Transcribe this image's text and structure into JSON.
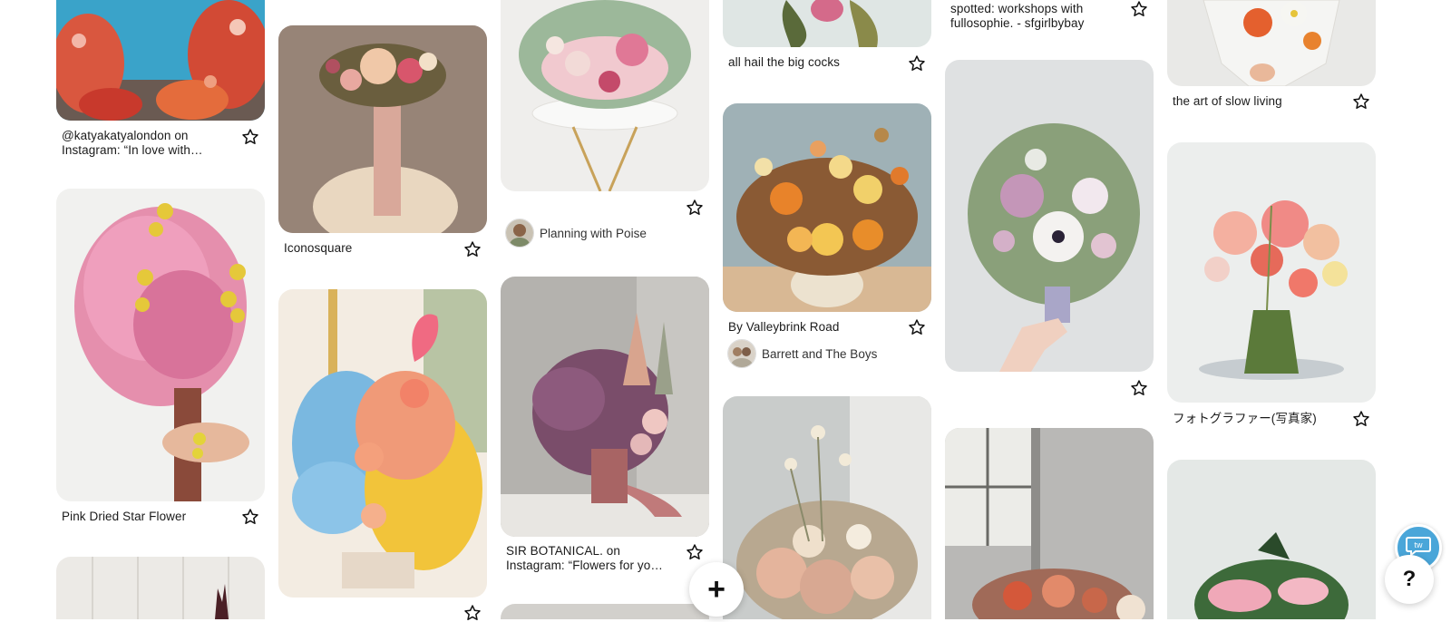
{
  "pins": [
    {
      "title": "@katyakatyalondon on Instagram: “In love with…"
    },
    {
      "title": "Pink Dried Star Flower"
    },
    {
      "title": "Iconosquare"
    },
    {
      "title": "",
      "attribution": "Planning with Poise"
    },
    {
      "title": "SIR BOTANICAL. on Instagram: “Flowers for yo…"
    },
    {
      "title": "all hail the big cocks"
    },
    {
      "title": "By Valleybrink Road",
      "attribution": "Barrett and The Boys"
    },
    {
      "title": "spotted: workshops with fullosophie. - sfgirlbybay"
    },
    {
      "title": "the art of slow living"
    },
    {
      "title": "フォトグラファー(写真家)"
    }
  ],
  "buttons": {
    "add": "+",
    "help": "?",
    "widget": "tw"
  },
  "icons": {
    "favorite": "star-outline-icon"
  },
  "colors": {
    "star_stroke": "#111111",
    "fab_bg": "#ffffff",
    "widget_bg": "#4aa6d9"
  }
}
